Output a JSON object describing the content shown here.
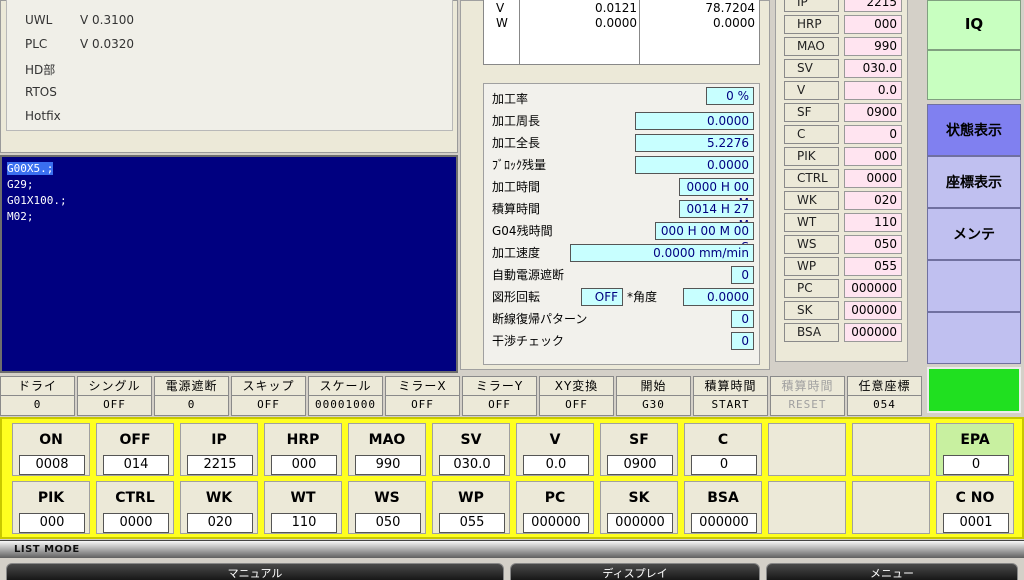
{
  "versions": [
    {
      "key": "UWL",
      "value": "V 0.3100"
    },
    {
      "key": "PLC",
      "value": "V 0.0320"
    },
    {
      "key": "HD部",
      "value": ""
    },
    {
      "key": "RTOS",
      "value": ""
    },
    {
      "key": "Hotfix",
      "value": ""
    }
  ],
  "program": {
    "lines": [
      "G00X5.;",
      "G29;",
      "G01X100.;",
      "M02;"
    ]
  },
  "vw": {
    "v_label": "V",
    "w_label": "W",
    "v_val1": "0.0121",
    "w_val1": "0.0000",
    "v_val2": "78.7204",
    "w_val2": "0.0000"
  },
  "process": {
    "rate_label": "加工率",
    "rate": "0 %",
    "perimeter_label": "加工周長",
    "perimeter": "0.0000",
    "total_label": "加工全長",
    "total": "5.2276",
    "block_label": "ﾌﾞﾛｯｸ残量",
    "block": "0.0000",
    "time_label": "加工時間",
    "time": "0000 H 00 M",
    "accum_label": "積算時間",
    "accum": "0014 H 27 M",
    "g04_label": "G04残時間",
    "g04": "000 H 00 M 00 S",
    "speed_label": "加工速度",
    "speed": "0.0000 mm/min",
    "autopower_label": "自動電源遮断",
    "autopower": "0",
    "rotate_label": "図形回転",
    "rotate": "OFF",
    "angle_label": "*角度",
    "angle": "0.0000",
    "wire_label": "断線復帰パターン",
    "wire": "0",
    "interference_label": "干渉チェック",
    "interference": "0"
  },
  "params": [
    {
      "key": "IP",
      "value": "2215"
    },
    {
      "key": "HRP",
      "value": "000"
    },
    {
      "key": "MAO",
      "value": "990"
    },
    {
      "key": "SV",
      "value": "030.0"
    },
    {
      "key": "V",
      "value": "0.0"
    },
    {
      "key": "SF",
      "value": "0900"
    },
    {
      "key": "C",
      "value": "0"
    },
    {
      "key": "PIK",
      "value": "000"
    },
    {
      "key": "CTRL",
      "value": "0000"
    },
    {
      "key": "WK",
      "value": "020"
    },
    {
      "key": "WT",
      "value": "110"
    },
    {
      "key": "WS",
      "value": "050"
    },
    {
      "key": "WP",
      "value": "055"
    },
    {
      "key": "PC",
      "value": "000000"
    },
    {
      "key": "SK",
      "value": "000000"
    },
    {
      "key": "BSA",
      "value": "000000"
    }
  ],
  "right_buttons": {
    "iq": "IQ",
    "status": "状態表示",
    "coords": "座標表示",
    "maint": "メンテ"
  },
  "modes": [
    {
      "label": "ドライ",
      "value": "0"
    },
    {
      "label": "シングル",
      "value": "OFF"
    },
    {
      "label": "電源遮断",
      "value": "0"
    },
    {
      "label": "スキップ",
      "value": "OFF"
    },
    {
      "label": "スケール",
      "value": "00001000"
    },
    {
      "label": "ミラーX",
      "value": "OFF"
    },
    {
      "label": "ミラーY",
      "value": "OFF"
    },
    {
      "label": "XY変換",
      "value": "OFF"
    },
    {
      "label": "開始",
      "value": "G30"
    },
    {
      "label": "積算時間",
      "value": "START"
    },
    {
      "label": "積算時間",
      "value": "RESET"
    },
    {
      "label": "任意座標",
      "value": "054"
    }
  ],
  "grid_row1": [
    {
      "label": "ON",
      "value": "0008"
    },
    {
      "label": "OFF",
      "value": "014"
    },
    {
      "label": "IP",
      "value": "2215"
    },
    {
      "label": "HRP",
      "value": "000"
    },
    {
      "label": "MAO",
      "value": "990"
    },
    {
      "label": "SV",
      "value": "030.0"
    },
    {
      "label": "V",
      "value": "0.0"
    },
    {
      "label": "SF",
      "value": "0900"
    },
    {
      "label": "C",
      "value": "0"
    },
    {
      "label": "",
      "value": ""
    },
    {
      "label": "",
      "value": ""
    },
    {
      "label": "EPA",
      "value": "0"
    }
  ],
  "grid_row2": [
    {
      "label": "PIK",
      "value": "000"
    },
    {
      "label": "CTRL",
      "value": "0000"
    },
    {
      "label": "WK",
      "value": "020"
    },
    {
      "label": "WT",
      "value": "110"
    },
    {
      "label": "WS",
      "value": "050"
    },
    {
      "label": "WP",
      "value": "055"
    },
    {
      "label": "PC",
      "value": "000000"
    },
    {
      "label": "SK",
      "value": "000000"
    },
    {
      "label": "BSA",
      "value": "000000"
    },
    {
      "label": "",
      "value": ""
    },
    {
      "label": "",
      "value": ""
    },
    {
      "label": "C NO",
      "value": "0001"
    }
  ],
  "list_mode": "LIST MODE",
  "bottom_tabs": [
    "マニュアル",
    "ディスプレイ",
    "メニュー"
  ],
  "colors": {
    "program_bg": "#000080",
    "grid_bg": "#ffff20",
    "iq_bg": "#c8ffc0",
    "status_bg": "#8080f0",
    "green": "#20e020"
  }
}
